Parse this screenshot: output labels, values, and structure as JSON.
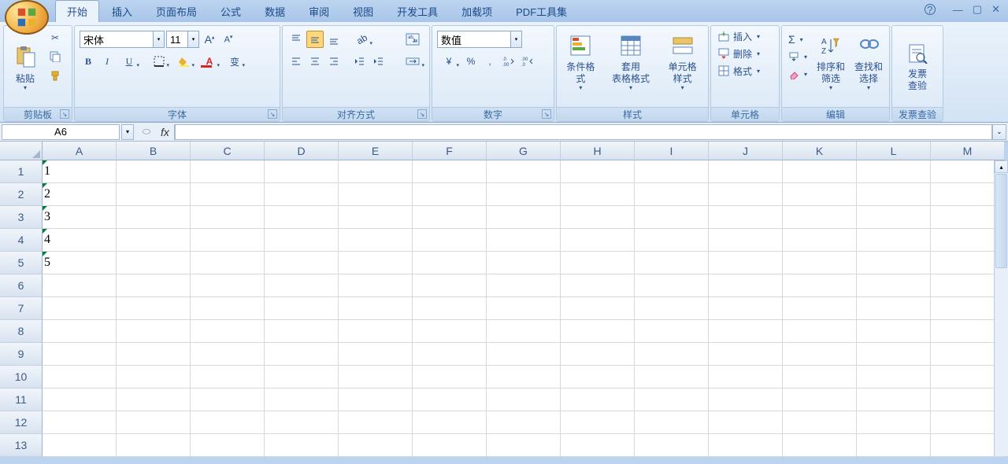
{
  "tabs": {
    "t0": "开始",
    "t1": "插入",
    "t2": "页面布局",
    "t3": "公式",
    "t4": "数据",
    "t5": "审阅",
    "t6": "视图",
    "t7": "开发工具",
    "t8": "加载项",
    "t9": "PDF工具集"
  },
  "ribbon": {
    "clipboard": {
      "paste": "粘贴",
      "label": "剪贴板"
    },
    "font": {
      "name": "宋体",
      "size": "11",
      "label": "字体"
    },
    "alignment": {
      "label": "对齐方式"
    },
    "number": {
      "format": "数值",
      "label": "数字"
    },
    "styles": {
      "cond": "条件格式",
      "table": "套用\n表格格式",
      "cell": "单元格\n样式",
      "label": "样式"
    },
    "cells": {
      "insert": "插入",
      "delete": "删除",
      "format": "格式",
      "label": "单元格"
    },
    "editing": {
      "sort": "排序和\n筛选",
      "find": "查找和\n选择",
      "label": "编辑"
    },
    "invoice": {
      "btn": "发票\n查验",
      "label": "发票查验"
    }
  },
  "namebox": "A6",
  "fx": "fx",
  "columns": [
    "A",
    "B",
    "C",
    "D",
    "E",
    "F",
    "G",
    "H",
    "I",
    "J",
    "K",
    "L",
    "M"
  ],
  "rows": [
    "1",
    "2",
    "3",
    "4",
    "5",
    "6",
    "7",
    "8",
    "9",
    "10",
    "11",
    "12",
    "13"
  ],
  "cell_data": {
    "A1": "1",
    "A2": "2",
    "A3": "3",
    "A4": "4",
    "A5": "5"
  },
  "glyph": {
    "sigma": "Σ",
    "percent": "%",
    "comma": ",",
    "currency": "¥",
    "inc": ".0→.00",
    "dec": ".00→.0"
  }
}
